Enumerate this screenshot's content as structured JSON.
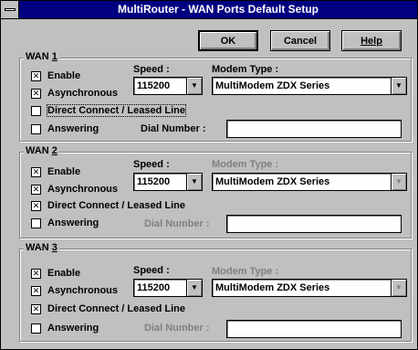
{
  "window": {
    "title": "MultiRouter - WAN Ports Default Setup"
  },
  "buttons": {
    "ok": "OK",
    "cancel": "Cancel",
    "help": "Help"
  },
  "labels": {
    "speed": "Speed :",
    "modem_type": "Modem Type :",
    "dial_number": "Dial Number :",
    "enable": "Enable",
    "asynchronous": "Asynchronous",
    "direct_connect": "Direct Connect / Leased Line",
    "answering": "Answering"
  },
  "wan": [
    {
      "title": "WAN ",
      "number": "1",
      "enable": true,
      "asynchronous": true,
      "direct_connect": false,
      "answering": false,
      "speed": "115200",
      "modem_type": "MultiModem ZDX Series",
      "modem_enabled": true,
      "dial_number": ""
    },
    {
      "title": "WAN ",
      "number": "2",
      "enable": true,
      "asynchronous": true,
      "direct_connect": true,
      "answering": false,
      "speed": "115200",
      "modem_type": "MultiModem ZDX Series",
      "modem_enabled": false,
      "dial_number": ""
    },
    {
      "title": "WAN ",
      "number": "3",
      "enable": true,
      "asynchronous": true,
      "direct_connect": true,
      "answering": false,
      "speed": "115200",
      "modem_type": "MultiModem ZDX Series",
      "modem_enabled": false,
      "dial_number": ""
    }
  ],
  "icons": {
    "system_menu": "system-menu-icon",
    "combo_arrow": "dropdown-arrow-icon",
    "checkbox_mark": "x-check-icon"
  },
  "colors": {
    "titlebar": "#000080",
    "face": "#c0c0c0",
    "disabled_text": "#808080"
  }
}
